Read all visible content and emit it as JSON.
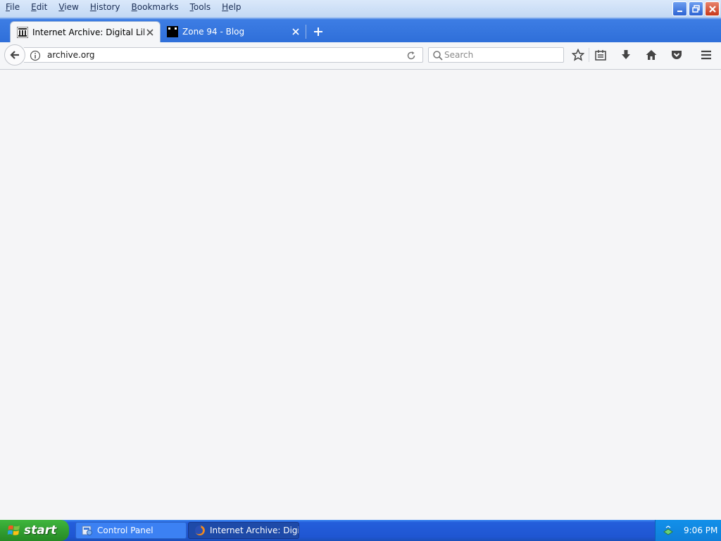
{
  "menu": {
    "items": [
      {
        "accel": "F",
        "rest": "ile"
      },
      {
        "accel": "E",
        "rest": "dit"
      },
      {
        "accel": "V",
        "rest": "iew"
      },
      {
        "accel": "H",
        "rest": "istory"
      },
      {
        "accel": "B",
        "rest": "ookmarks"
      },
      {
        "accel": "T",
        "rest": "ools"
      },
      {
        "accel": "H",
        "rest": "elp"
      }
    ]
  },
  "tabs": [
    {
      "title": "Internet Archive: Digital Libra...",
      "favicon": "archive-icon",
      "active": true
    },
    {
      "title": "Zone 94 - Blog",
      "favicon": "zone94-icon",
      "active": false
    }
  ],
  "navbar": {
    "url": "archive.org",
    "search_placeholder": "Search"
  },
  "taskbar": {
    "start_label": "start",
    "tasks": [
      {
        "label": "Control Panel",
        "icon": "control-panel-icon"
      },
      {
        "label": "Internet Archive: Digi...",
        "icon": "firefox-icon"
      }
    ],
    "clock": "9:06 PM"
  },
  "colors": {
    "tabstrip": "#2f6fd9",
    "taskbar": "#245edb",
    "start_button": "#2f9a2e",
    "close_button": "#c7381b"
  }
}
